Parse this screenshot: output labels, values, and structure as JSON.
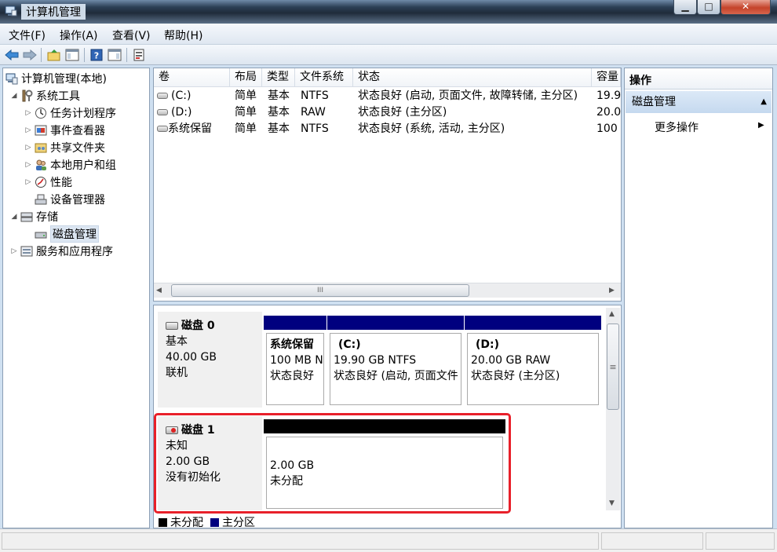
{
  "window": {
    "title": "计算机管理",
    "min": "▁",
    "max": "□",
    "close": "✕"
  },
  "menu": [
    "文件(F)",
    "操作(A)",
    "查看(V)",
    "帮助(H)"
  ],
  "tree": [
    {
      "label": "计算机管理(本地)",
      "arrow": ""
    },
    {
      "label": "系统工具",
      "arrow": "◢"
    },
    {
      "label": "任务计划程序",
      "arrow": "▷"
    },
    {
      "label": "事件查看器",
      "arrow": "▷"
    },
    {
      "label": "共享文件夹",
      "arrow": "▷"
    },
    {
      "label": "本地用户和组",
      "arrow": "▷"
    },
    {
      "label": "性能",
      "arrow": "▷"
    },
    {
      "label": "设备管理器",
      "arrow": ""
    },
    {
      "label": "存储",
      "arrow": "◢"
    },
    {
      "label": "磁盘管理",
      "arrow": ""
    },
    {
      "label": "服务和应用程序",
      "arrow": "▷"
    }
  ],
  "volumes": {
    "headers": [
      "卷",
      "布局",
      "类型",
      "文件系统",
      "状态",
      "容量"
    ],
    "rows": [
      {
        "vol": "(C:)",
        "layout": "简单",
        "type": "基本",
        "fs": "NTFS",
        "status": "状态良好 (启动, 页面文件, 故障转储, 主分区)",
        "cap": "19.9"
      },
      {
        "vol": "(D:)",
        "layout": "简单",
        "type": "基本",
        "fs": "RAW",
        "status": "状态良好 (主分区)",
        "cap": "20.0"
      },
      {
        "vol": "系统保留",
        "layout": "简单",
        "type": "基本",
        "fs": "NTFS",
        "status": "状态良好 (系统, 活动, 主分区)",
        "cap": "100"
      }
    ],
    "hscroll_grip": "III"
  },
  "disks": [
    {
      "name": "磁盘 0",
      "type": "基本",
      "size": "40.00 GB",
      "state": "联机",
      "partitions": [
        {
          "name": "系统保留",
          "size": "100 MB N",
          "status": "状态良好"
        },
        {
          "name": "(C:)",
          "size": "19.90 GB NTFS",
          "status": "状态良好 (启动, 页面文件"
        },
        {
          "name": "(D:)",
          "size": "20.00 GB RAW",
          "status": "状态良好 (主分区)"
        }
      ]
    },
    {
      "name": "磁盘 1",
      "type": "未知",
      "size": "2.00 GB",
      "state": "没有初始化",
      "partitions": [
        {
          "size": "2.00 GB",
          "status": "未分配"
        }
      ]
    }
  ],
  "vscroll_grip": "≡",
  "legend": [
    {
      "label": "未分配",
      "color": "#000000"
    },
    {
      "label": "主分区",
      "color": "#00007f"
    }
  ],
  "actions": {
    "header": "操作",
    "section": "磁盘管理",
    "item": "更多操作"
  },
  "colors": {
    "primary_partition": "#00007f",
    "unallocated": "#000000",
    "highlight": "#e8202a"
  }
}
